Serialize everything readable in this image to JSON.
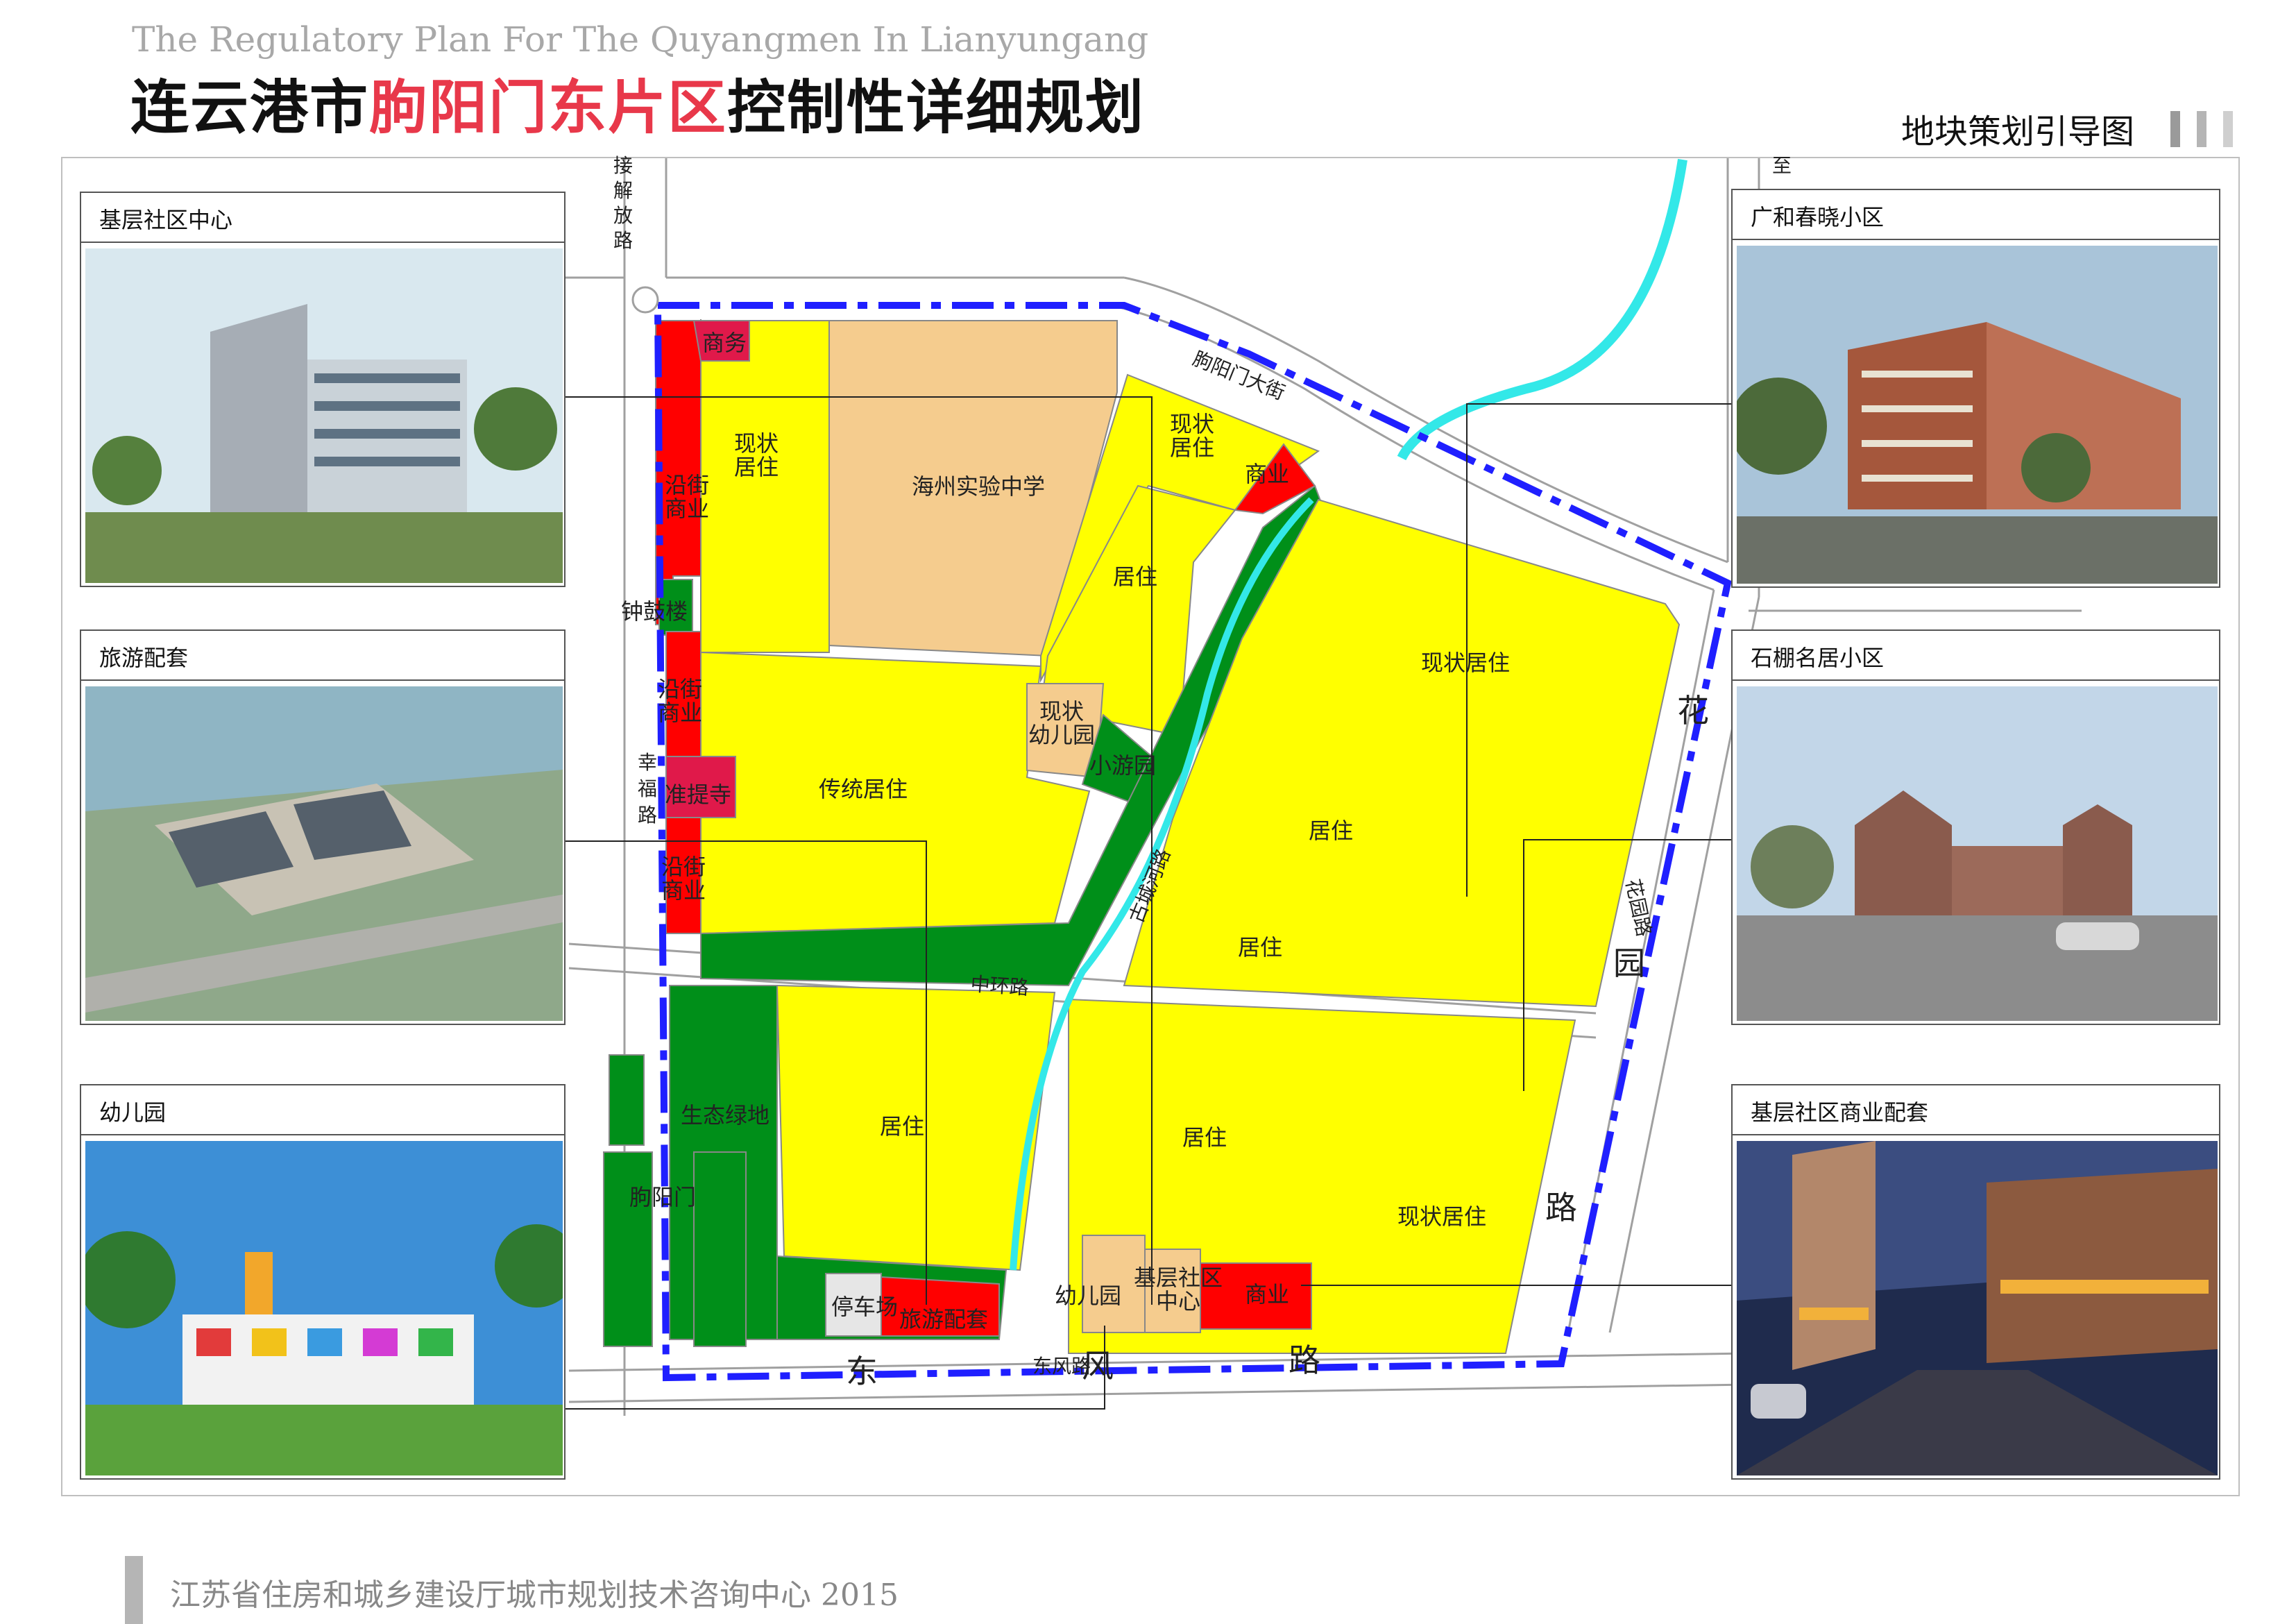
{
  "header": {
    "title_en": "The Regulatory Plan For The Quyangmen In Lianyungang",
    "title_cn_part1": "连云港市",
    "title_cn_part2": "朐阳门东片区",
    "title_cn_part3": "控制性详细规划",
    "subtitle": "地块策划引导图"
  },
  "colors": {
    "residential": "#ffff00",
    "commercial": "#ff0000",
    "business": "#e0194a",
    "school": "#f5cc8e",
    "green": "#008f19",
    "water": "#33e8e8",
    "boundary": "#1f1fff",
    "parking": "#e6e6e6"
  },
  "panels": {
    "community_center": "基层社区中心",
    "tourism": "旅游配套",
    "kindergarten": "幼儿园",
    "guanghe": "广和春晓小区",
    "shipeng": "石棚名居小区",
    "community_commerce": "基层社区商业配套"
  },
  "map": {
    "roads": {
      "jiefang_1": "接",
      "jiefang_2": "解",
      "jiefang_3": "放",
      "jiefang_4": "路",
      "zhi": "至",
      "xingfu_1": "幸",
      "xingfu_2": "福",
      "xingfu_3": "路",
      "quyangmen_st": "朐阳门大街",
      "zhonghuan": "中环路",
      "dongfeng_small": "东风路",
      "dongfeng_1": "东",
      "dongfeng_2": "风",
      "dongfeng_3": "路",
      "huayuan_1": "花",
      "huayuan_2": "园",
      "huayuan_3": "路",
      "huayuan_small": "花园路",
      "river": "古城河路"
    },
    "blocks": {
      "shangwu": "商务",
      "current_res_a1": "现状",
      "current_res_a2": "居住",
      "street_com_1a": "沿街",
      "street_com_1b": "商业",
      "school": "海州实验中学",
      "current_res_b1": "现状",
      "current_res_b2": "居住",
      "commercial_ne": "商业",
      "zhonggu": "钟鼓楼",
      "res_c": "居住",
      "street_com_2a": "沿街",
      "street_com_2b": "商业",
      "kinder_current_1": "现状",
      "kinder_current_2": "幼儿园",
      "xiaoyouyuan": "小游园",
      "zhunti": "准提寺",
      "traditional": "传统居住",
      "street_com_3a": "沿街",
      "street_com_3b": "商业",
      "current_res_east": "现状居住",
      "res_d": "居住",
      "res_e": "居住",
      "eco_green": "生态绿地",
      "quyangmen": "朐阳门",
      "res_f": "居住",
      "res_g": "居住",
      "current_res_se": "现状居住",
      "parking": "停车场",
      "tourism_support": "旅游配套",
      "kindergarten": "幼儿园",
      "community_1": "基层社区",
      "community_2": "中心",
      "commercial_s": "商业"
    }
  },
  "footer": {
    "text": "江苏省住房和城乡建设厅城市规划技术咨询中心 2015"
  }
}
